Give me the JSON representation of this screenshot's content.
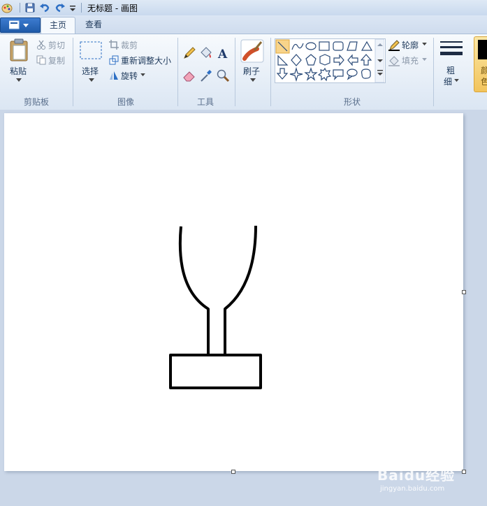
{
  "window": {
    "title": "无标题 - 画图"
  },
  "tabs": [
    {
      "label": "主页",
      "active": true
    },
    {
      "label": "查看",
      "active": false
    }
  ],
  "ribbon": {
    "clipboard": {
      "paste": "粘贴",
      "cut": "剪切",
      "copy": "复制",
      "group_label": "剪贴板"
    },
    "image": {
      "select": "选择",
      "crop": "裁剪",
      "resize": "重新调整大小",
      "rotate": "旋转",
      "group_label": "图像"
    },
    "tools": {
      "group_label": "工具"
    },
    "brushes": {
      "label": "刷子"
    },
    "shapes": {
      "outline": "轮廓",
      "fill": "填充",
      "group_label": "形状"
    },
    "size": {
      "label_line1": "粗",
      "label_line2": "细"
    },
    "color": {
      "label_line1": "颜",
      "label_line2": "色"
    }
  },
  "watermark": {
    "text": "Baidu经验",
    "sub": "jingyan.baidu.com"
  }
}
